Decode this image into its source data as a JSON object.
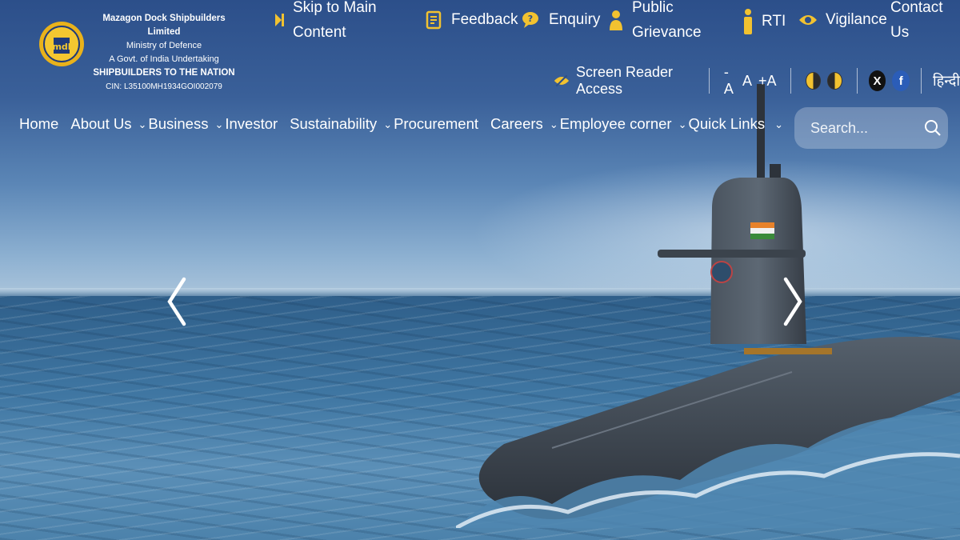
{
  "header": {
    "org_name": "Mazagon Dock Shipbuilders Limited",
    "ministry": "Ministry of Defence",
    "undertaking": "A Govt. of India Undertaking",
    "tagline": "SHIPBUILDERS TO THE NATION",
    "cin": "CIN: L35100MH1934GOI002079",
    "logo_text": "mdl"
  },
  "toplinks": {
    "skip_l1": "Skip to Main",
    "skip_l2": "Content",
    "feedback": "Feedback",
    "enquiry": "Enquiry",
    "grievance_l1": "Public",
    "grievance_l2": "Grievance",
    "rti": "RTI",
    "vigilance": "Vigilance",
    "contact_l1": "Contact",
    "contact_l2": "Us"
  },
  "access": {
    "screen_reader": "Screen Reader Access",
    "font_decrease": "-A",
    "font_normal": "A",
    "font_increase": "+A",
    "twitter": "X",
    "facebook": "f",
    "language": "हिन्दी"
  },
  "nav": {
    "home": "Home",
    "about": "About Us",
    "business": "Business",
    "investor": "Investor",
    "sustainability": "Sustainability",
    "procurement": "Procurement",
    "careers": "Careers",
    "employee": "Employee corner",
    "quick": "Quick Links"
  },
  "search": {
    "placeholder": "Search..."
  },
  "colors": {
    "accent": "#f2c230",
    "nav_text": "#ffffff"
  }
}
